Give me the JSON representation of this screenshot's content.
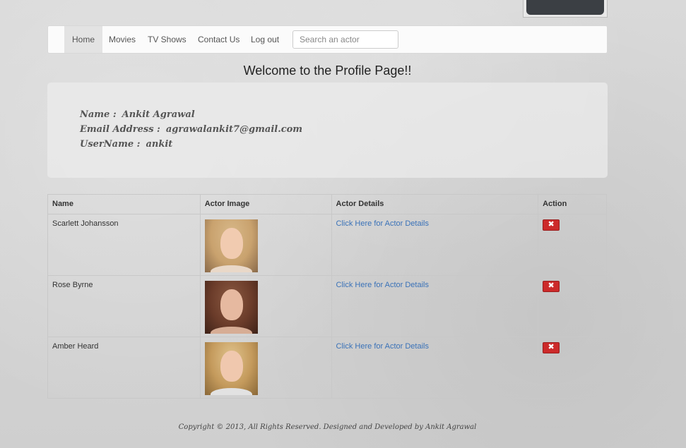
{
  "nav": {
    "items": [
      {
        "label": "Home",
        "active": true
      },
      {
        "label": "Movies",
        "active": false
      },
      {
        "label": "TV Shows",
        "active": false
      },
      {
        "label": "Contact Us",
        "active": false
      },
      {
        "label": "Log out",
        "active": false
      }
    ],
    "search_placeholder": "Search an actor"
  },
  "welcome": "Welcome to the Profile Page!!",
  "profile": {
    "name_label": "Name :",
    "name_value": "Ankit Agrawal",
    "email_label": "Email Address :",
    "email_value": "agrawalankit7@gmail.com",
    "username_label": "UserName :",
    "username_value": "ankit"
  },
  "table": {
    "headers": [
      "Name",
      "Actor Image",
      "Actor Details",
      "Action"
    ],
    "rows": [
      {
        "name": "Scarlett Johansson",
        "details_link": "Click Here for Actor Details"
      },
      {
        "name": "Rose Byrne",
        "details_link": "Click Here for Actor Details"
      },
      {
        "name": "Amber Heard",
        "details_link": "Click Here for Actor Details"
      }
    ]
  },
  "footer": "Copyright © 2013, All Rights Reserved. Designed and Developed by Ankit Agrawal",
  "colors": {
    "link": "#3a72b8",
    "delete_button": "#cc2a2a",
    "nav_active": "#e3e3e3"
  }
}
